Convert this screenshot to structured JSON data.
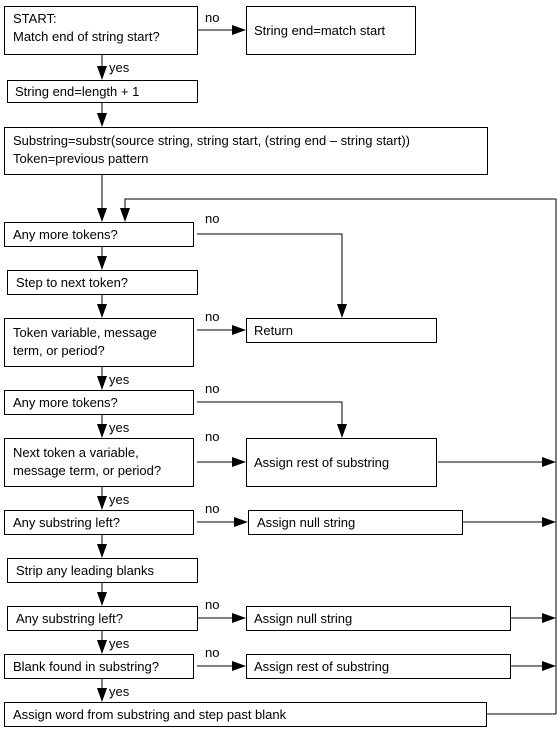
{
  "labels": {
    "no": "no",
    "yes": "yes"
  },
  "nodes": {
    "start": [
      "START:",
      "Match end of string start?"
    ],
    "end_match": [
      "String end=match start"
    ],
    "end_length": [
      "String end=length + 1"
    ],
    "substring": [
      "Substring=substr(source string, string start,   (string end – string start))",
      "Token=previous pattern"
    ],
    "more_tokens_1": [
      "Any more tokens?"
    ],
    "step_next": [
      "Step to next token?"
    ],
    "token_var": [
      "Token variable, message",
      "term,  or period?"
    ],
    "return": [
      "Return"
    ],
    "more_tokens_2": [
      "Any more tokens?"
    ],
    "next_token": [
      "Next token a variable,",
      "message term, or period?"
    ],
    "assign_rest_1": [
      "Assign rest of substring"
    ],
    "substring_left_1": [
      "Any substring left?"
    ],
    "assign_null_1": [
      "Assign null string"
    ],
    "strip": [
      "Strip any leading blanks"
    ],
    "substring_left_2": [
      "Any substring left?"
    ],
    "assign_null_2": [
      "Assign null string"
    ],
    "blank_found": [
      "Blank found in substring?"
    ],
    "assign_rest_2": [
      "Assign rest of substring"
    ],
    "assign_word": [
      "Assign word from substring and step past blank"
    ]
  }
}
